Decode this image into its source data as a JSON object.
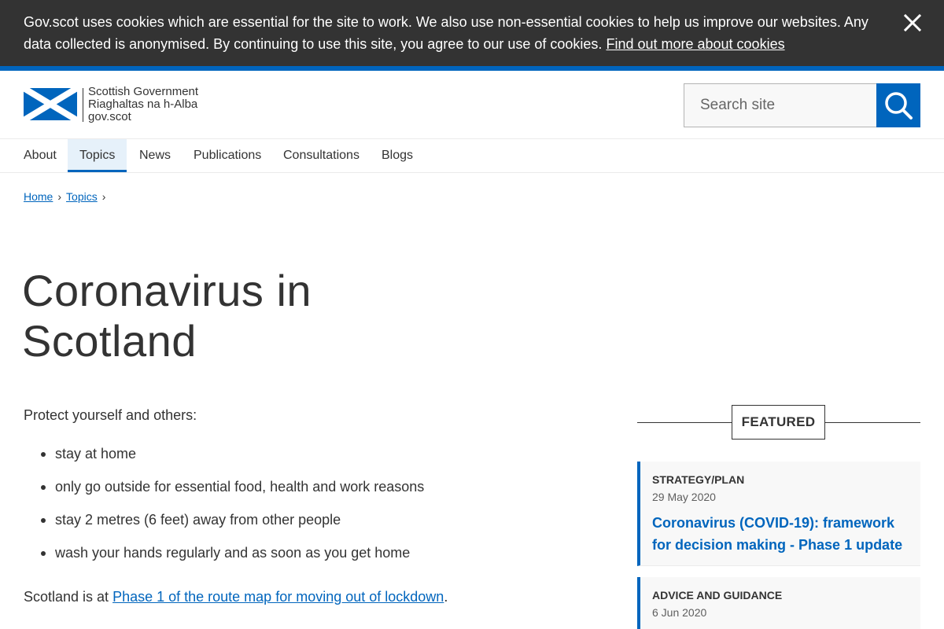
{
  "cookie_banner": {
    "message": "Gov.scot uses cookies which are essential for the site to work. We also use non-essential cookies to help us improve our websites. Any data collected is anonymised. By continuing to use this site, you agree to our use of cookies.",
    "link_label": "Find out more about cookies",
    "close_icon": "close-icon"
  },
  "header": {
    "logo_lines": [
      "Scottish Government",
      "Riaghaltas na h-Alba",
      "gov.scot"
    ],
    "search_placeholder": "Search site",
    "search_icon": "search-icon"
  },
  "nav": {
    "items": [
      {
        "label": "About",
        "active": false
      },
      {
        "label": "Topics",
        "active": true
      },
      {
        "label": "News",
        "active": false
      },
      {
        "label": "Publications",
        "active": false
      },
      {
        "label": "Consultations",
        "active": false
      },
      {
        "label": "Blogs",
        "active": false
      }
    ]
  },
  "breadcrumb": {
    "items": [
      "Home",
      "Topics"
    ],
    "separator": "›"
  },
  "page": {
    "title": "Coronavirus in Scotland",
    "intro": "Protect yourself and others:",
    "bullets": [
      "stay at home",
      "only go outside for essential food, health and work reasons",
      "stay 2 metres (6 feet) away from other people",
      "wash your hands regularly and as soon as you get home"
    ],
    "phase_prefix": "Scotland is at ",
    "phase_link": "Phase 1 of the route map for moving out of lockdown",
    "phase_suffix": "."
  },
  "featured": {
    "label": "FEATURED",
    "cards": [
      {
        "type": "STRATEGY/PLAN",
        "date": "29 May 2020",
        "title": "Coronavirus (COVID-19): framework for decision making - Phase 1 update"
      },
      {
        "type": "ADVICE AND GUIDANCE",
        "date": "6 Jun 2020",
        "title": ""
      }
    ]
  },
  "colors": {
    "brand_blue": "#0065bd",
    "banner_bg": "#333333",
    "nav_active_bg": "#e6f1fa"
  }
}
